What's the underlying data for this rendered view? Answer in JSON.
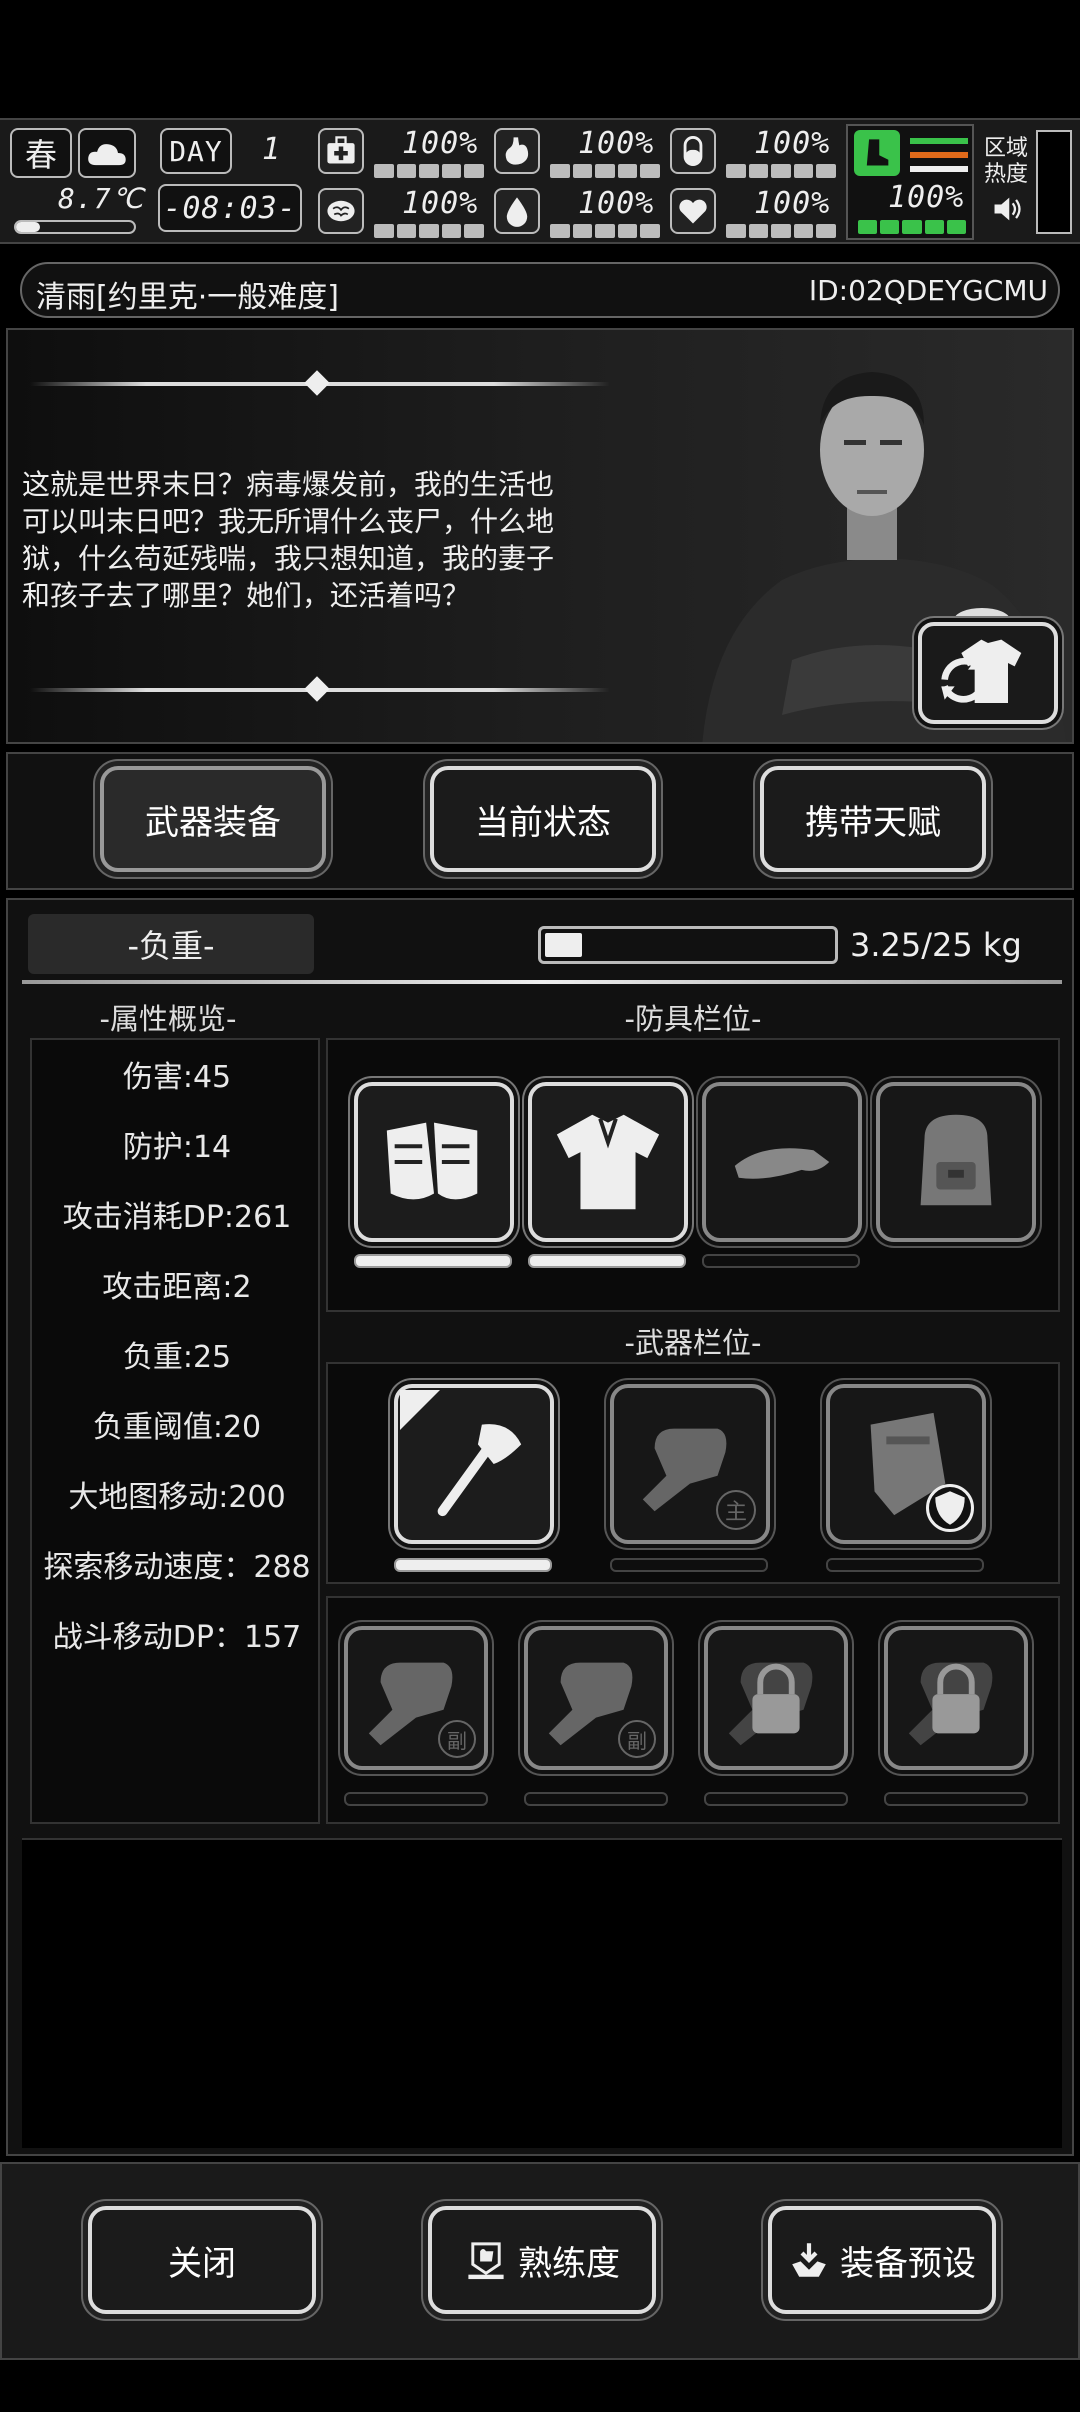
{
  "hud": {
    "season": "春",
    "temperature": "8.7℃",
    "day_label": "DAY",
    "day_number": "1",
    "time": "-08:03-",
    "area_heat_label_1": "区域",
    "area_heat_label_2": "热度",
    "stats": {
      "health": "100%",
      "hunger": "100%",
      "energy": "100%",
      "mood": "100%",
      "thirst": "100%",
      "heart": "100%",
      "stamina": "100%"
    }
  },
  "header": {
    "save_title": "清雨[约里克·一般难度]",
    "player_id": "ID:02QDEYGCMU"
  },
  "story": {
    "text_lines": [
      "这就是世界末日？病毒爆发前，我的生活也",
      "可以叫末日吧？我无所谓什么丧尸，什么地",
      "狱，什么苟延残喘，我只想知道，我的妻子",
      "和孩子去了哪里？她们，还活着吗？"
    ]
  },
  "tabs": {
    "weapons": "武器装备",
    "status": "当前状态",
    "talents": "携带天赋"
  },
  "load": {
    "label": "-负重-",
    "value_text": "3.25/25 kg",
    "fraction": 0.13
  },
  "attributes": {
    "title": "-属性概览-",
    "items": [
      "伤害:45",
      "防护:14",
      "攻击消耗DP:261",
      "攻击距离:2",
      "负重:25",
      "负重阈值:20",
      "大地图移动:200",
      "探索移动速度：288",
      "战斗移动DP：157"
    ]
  },
  "armor": {
    "title": "-防具栏位-"
  },
  "weapons": {
    "title": "-武器栏位-",
    "main_badge": "主",
    "sub_badge": "副"
  },
  "footer": {
    "close": "关闭",
    "proficiency": "熟练度",
    "preset": "装备预设"
  },
  "colors": {
    "accent_green": "#3ac24a",
    "accent_orange": "#e06a1a"
  }
}
